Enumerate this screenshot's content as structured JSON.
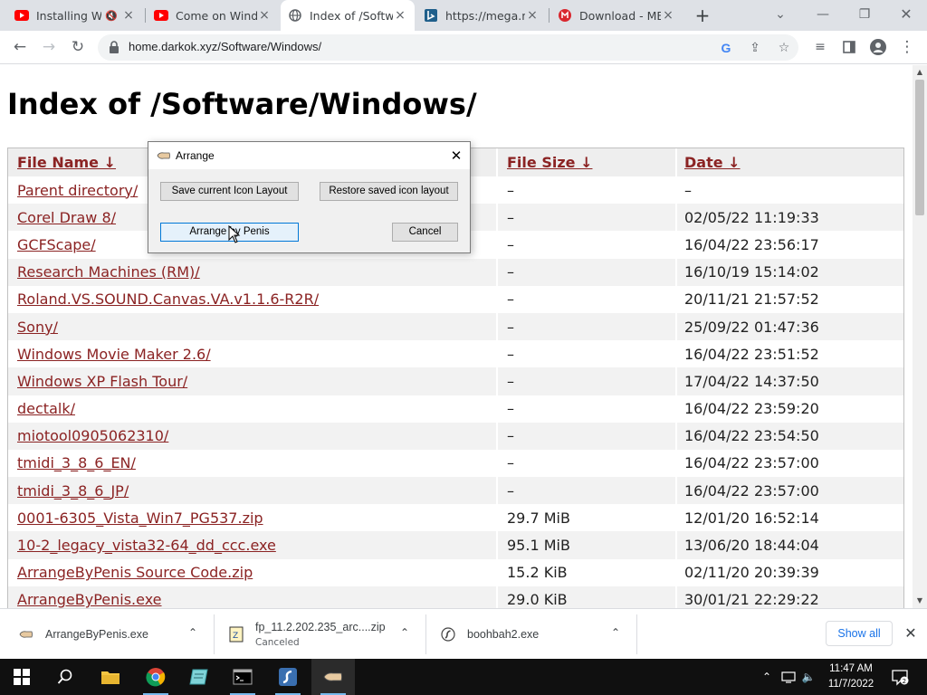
{
  "browser": {
    "tabs": [
      {
        "title": "Installing W",
        "favicon": "youtube-icon",
        "muted": true
      },
      {
        "title": "Come on Wind",
        "favicon": "youtube-icon"
      },
      {
        "title": "Index of /Softw",
        "favicon": "globe-icon",
        "active": true
      },
      {
        "title": "https://mega.n",
        "favicon": "bing-icon"
      },
      {
        "title": "Download - ME",
        "favicon": "mega-icon"
      }
    ],
    "url": "home.darkok.xyz/Software/Windows/"
  },
  "page": {
    "heading": "Index of /Software/Windows/",
    "columns": {
      "name": "File Name  ↓",
      "size": "File Size  ↓",
      "date": "Date  ↓"
    },
    "rows": [
      {
        "name": "Parent directory/",
        "size": "–",
        "date": "–"
      },
      {
        "name": "Corel Draw 8/",
        "size": "–",
        "date": "02/05/22 11:19:33"
      },
      {
        "name": "GCFScape/",
        "size": "–",
        "date": "16/04/22 23:56:17"
      },
      {
        "name": "Research Machines (RM)/",
        "size": "–",
        "date": "16/10/19 15:14:02"
      },
      {
        "name": "Roland.VS.SOUND.Canvas.VA.v1.1.6-R2R/",
        "size": "–",
        "date": "20/11/21 21:57:52"
      },
      {
        "name": "Sony/",
        "size": "–",
        "date": "25/09/22 01:47:36"
      },
      {
        "name": "Windows Movie Maker 2.6/",
        "size": "–",
        "date": "16/04/22 23:51:52"
      },
      {
        "name": "Windows XP Flash Tour/",
        "size": "–",
        "date": "17/04/22 14:37:50"
      },
      {
        "name": "dectalk/",
        "size": "–",
        "date": "16/04/22 23:59:20"
      },
      {
        "name": "miotool0905062310/",
        "size": "–",
        "date": "16/04/22 23:54:50"
      },
      {
        "name": "tmidi_3_8_6_EN/",
        "size": "–",
        "date": "16/04/22 23:57:00"
      },
      {
        "name": "tmidi_3_8_6_JP/",
        "size": "–",
        "date": "16/04/22 23:57:00"
      },
      {
        "name": "0001-6305_Vista_Win7_PG537.zip",
        "size": "29.7 MiB",
        "date": "12/01/20 16:52:14"
      },
      {
        "name": "10-2_legacy_vista32-64_dd_ccc.exe",
        "size": "95.1 MiB",
        "date": "13/06/20 18:44:04"
      },
      {
        "name": "ArrangeByPenis Source Code.zip",
        "size": "15.2 KiB",
        "date": "02/11/20 20:39:39"
      },
      {
        "name": "ArrangeByPenis.exe",
        "size": "29.0 KiB",
        "date": "30/01/21 22:29:22"
      }
    ]
  },
  "dialog": {
    "title": "Arrange",
    "save_label": "Save current Icon Layout",
    "restore_label": "Restore saved icon layout",
    "arrange_label": "Arrange by Penis",
    "cancel_label": "Cancel"
  },
  "downloads": {
    "items": [
      {
        "name": "ArrangeByPenis.exe",
        "status": ""
      },
      {
        "name": "fp_11.2.202.235_arc....zip",
        "status": "Canceled"
      },
      {
        "name": "boohbah2.exe",
        "status": ""
      }
    ],
    "show_all": "Show all"
  },
  "taskbar": {
    "time": "11:47 AM",
    "date": "11/7/2022"
  },
  "colors": {
    "link": "#8b2323",
    "accent": "#1a73e8",
    "taskbar": "#101010"
  }
}
